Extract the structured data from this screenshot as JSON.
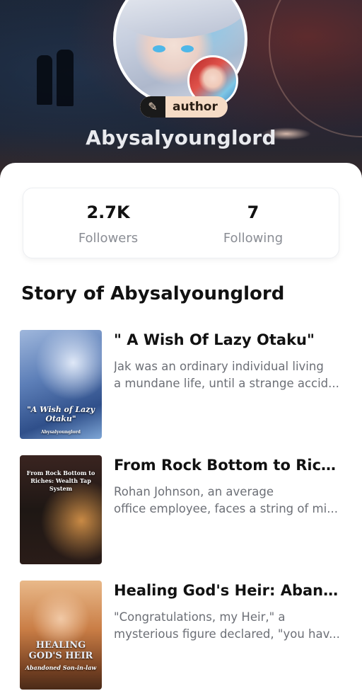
{
  "profile": {
    "badge_label": "author",
    "username": "Abysalyounglord"
  },
  "stats": {
    "followers_value": "2.7K",
    "followers_label": "Followers",
    "following_value": "7",
    "following_label": "Following"
  },
  "section": {
    "title": "Story of Abysalyounglord"
  },
  "stories": [
    {
      "title": "\" A Wish Of Lazy Otaku\"",
      "desc_line1": "Jak was an ordinary individual living",
      "desc_line2": "a mundane life, until a strange accid...",
      "cover_text": "\"A Wish of Lazy Otaku\"",
      "cover_author": "Abysalyounglord"
    },
    {
      "title": "From Rock Bottom to Rich...",
      "desc_line1": "Rohan Johnson, an average",
      "desc_line2": "office employee, faces a string of mi...",
      "cover_text": "From Rock Bottom to Riches: Wealth Tap System"
    },
    {
      "title": "Healing God's Heir: Aband...",
      "desc_line1": "\"Congratulations, my Heir,\" a",
      "desc_line2": "mysterious figure declared, \"you hav...",
      "cover_text": "HEALING GOD'S HEIR",
      "cover_subtitle": "Abandoned Son-in-law"
    }
  ],
  "icons": {
    "badge_icon": "feather-icon"
  },
  "colors": {
    "badge_bg": "#f6dcc6",
    "header_dark": "#1b2536",
    "muted_text": "#8a8d94"
  }
}
